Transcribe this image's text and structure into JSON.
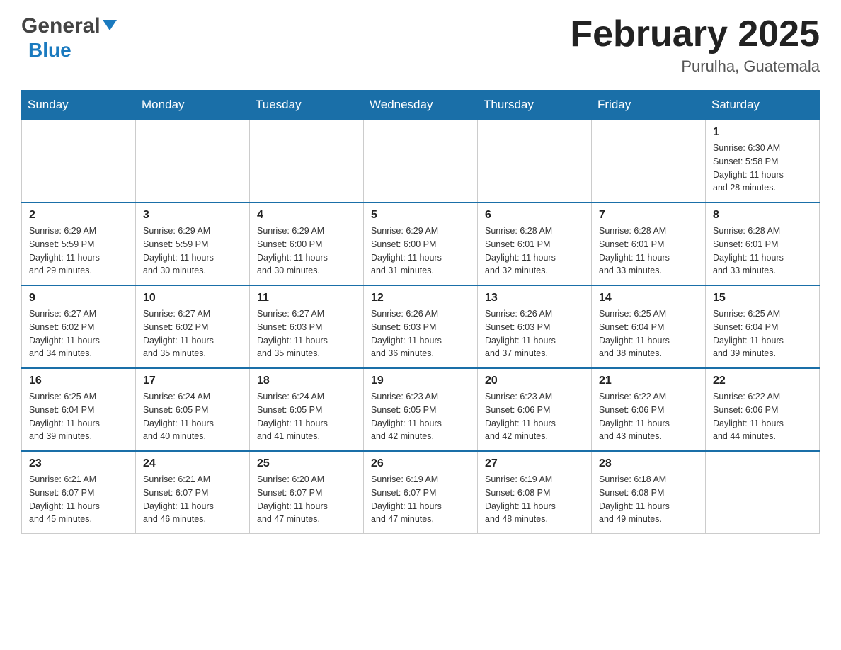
{
  "header": {
    "logo_general": "General",
    "logo_blue": "Blue",
    "month_title": "February 2025",
    "location": "Purulha, Guatemala"
  },
  "weekdays": [
    "Sunday",
    "Monday",
    "Tuesday",
    "Wednesday",
    "Thursday",
    "Friday",
    "Saturday"
  ],
  "weeks": [
    [
      {
        "day": "",
        "info": ""
      },
      {
        "day": "",
        "info": ""
      },
      {
        "day": "",
        "info": ""
      },
      {
        "day": "",
        "info": ""
      },
      {
        "day": "",
        "info": ""
      },
      {
        "day": "",
        "info": ""
      },
      {
        "day": "1",
        "info": "Sunrise: 6:30 AM\nSunset: 5:58 PM\nDaylight: 11 hours\nand 28 minutes."
      }
    ],
    [
      {
        "day": "2",
        "info": "Sunrise: 6:29 AM\nSunset: 5:59 PM\nDaylight: 11 hours\nand 29 minutes."
      },
      {
        "day": "3",
        "info": "Sunrise: 6:29 AM\nSunset: 5:59 PM\nDaylight: 11 hours\nand 30 minutes."
      },
      {
        "day": "4",
        "info": "Sunrise: 6:29 AM\nSunset: 6:00 PM\nDaylight: 11 hours\nand 30 minutes."
      },
      {
        "day": "5",
        "info": "Sunrise: 6:29 AM\nSunset: 6:00 PM\nDaylight: 11 hours\nand 31 minutes."
      },
      {
        "day": "6",
        "info": "Sunrise: 6:28 AM\nSunset: 6:01 PM\nDaylight: 11 hours\nand 32 minutes."
      },
      {
        "day": "7",
        "info": "Sunrise: 6:28 AM\nSunset: 6:01 PM\nDaylight: 11 hours\nand 33 minutes."
      },
      {
        "day": "8",
        "info": "Sunrise: 6:28 AM\nSunset: 6:01 PM\nDaylight: 11 hours\nand 33 minutes."
      }
    ],
    [
      {
        "day": "9",
        "info": "Sunrise: 6:27 AM\nSunset: 6:02 PM\nDaylight: 11 hours\nand 34 minutes."
      },
      {
        "day": "10",
        "info": "Sunrise: 6:27 AM\nSunset: 6:02 PM\nDaylight: 11 hours\nand 35 minutes."
      },
      {
        "day": "11",
        "info": "Sunrise: 6:27 AM\nSunset: 6:03 PM\nDaylight: 11 hours\nand 35 minutes."
      },
      {
        "day": "12",
        "info": "Sunrise: 6:26 AM\nSunset: 6:03 PM\nDaylight: 11 hours\nand 36 minutes."
      },
      {
        "day": "13",
        "info": "Sunrise: 6:26 AM\nSunset: 6:03 PM\nDaylight: 11 hours\nand 37 minutes."
      },
      {
        "day": "14",
        "info": "Sunrise: 6:25 AM\nSunset: 6:04 PM\nDaylight: 11 hours\nand 38 minutes."
      },
      {
        "day": "15",
        "info": "Sunrise: 6:25 AM\nSunset: 6:04 PM\nDaylight: 11 hours\nand 39 minutes."
      }
    ],
    [
      {
        "day": "16",
        "info": "Sunrise: 6:25 AM\nSunset: 6:04 PM\nDaylight: 11 hours\nand 39 minutes."
      },
      {
        "day": "17",
        "info": "Sunrise: 6:24 AM\nSunset: 6:05 PM\nDaylight: 11 hours\nand 40 minutes."
      },
      {
        "day": "18",
        "info": "Sunrise: 6:24 AM\nSunset: 6:05 PM\nDaylight: 11 hours\nand 41 minutes."
      },
      {
        "day": "19",
        "info": "Sunrise: 6:23 AM\nSunset: 6:05 PM\nDaylight: 11 hours\nand 42 minutes."
      },
      {
        "day": "20",
        "info": "Sunrise: 6:23 AM\nSunset: 6:06 PM\nDaylight: 11 hours\nand 42 minutes."
      },
      {
        "day": "21",
        "info": "Sunrise: 6:22 AM\nSunset: 6:06 PM\nDaylight: 11 hours\nand 43 minutes."
      },
      {
        "day": "22",
        "info": "Sunrise: 6:22 AM\nSunset: 6:06 PM\nDaylight: 11 hours\nand 44 minutes."
      }
    ],
    [
      {
        "day": "23",
        "info": "Sunrise: 6:21 AM\nSunset: 6:07 PM\nDaylight: 11 hours\nand 45 minutes."
      },
      {
        "day": "24",
        "info": "Sunrise: 6:21 AM\nSunset: 6:07 PM\nDaylight: 11 hours\nand 46 minutes."
      },
      {
        "day": "25",
        "info": "Sunrise: 6:20 AM\nSunset: 6:07 PM\nDaylight: 11 hours\nand 47 minutes."
      },
      {
        "day": "26",
        "info": "Sunrise: 6:19 AM\nSunset: 6:07 PM\nDaylight: 11 hours\nand 47 minutes."
      },
      {
        "day": "27",
        "info": "Sunrise: 6:19 AM\nSunset: 6:08 PM\nDaylight: 11 hours\nand 48 minutes."
      },
      {
        "day": "28",
        "info": "Sunrise: 6:18 AM\nSunset: 6:08 PM\nDaylight: 11 hours\nand 49 minutes."
      },
      {
        "day": "",
        "info": ""
      }
    ]
  ]
}
